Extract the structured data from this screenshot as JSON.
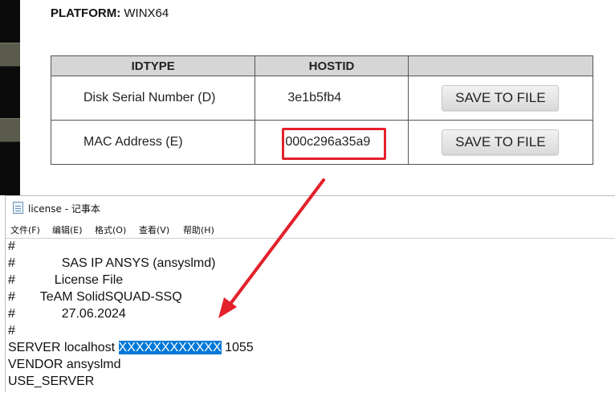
{
  "platform": {
    "label": "PLATFORM:",
    "value": "WINX64"
  },
  "table": {
    "headers": [
      "IDTYPE",
      "HOSTID",
      ""
    ],
    "rows": [
      {
        "idtype": "Disk Serial Number (D)",
        "hostid": "3e1b5fb4",
        "action": "SAVE TO FILE"
      },
      {
        "idtype": "MAC Address (E)",
        "hostid": "000c296a35a9",
        "action": "SAVE TO FILE"
      }
    ]
  },
  "annotation": {
    "color": "#e3212b"
  },
  "notepad": {
    "title": "license - 记事本",
    "menu": [
      "文件(F)",
      "编辑(E)",
      "格式(O)",
      "查看(V)",
      "帮助(H)"
    ],
    "lines": [
      "#",
      "#             SAS IP ANSYS (ansyslmd)",
      "#           License File",
      "#       TeAM SolidSQUAD-SSQ",
      "#             27.06.2024",
      "#"
    ],
    "server": {
      "prefix": "SERVER localhost ",
      "selected": "XXXXXXXXXXXX",
      "suffix": " 1055"
    },
    "vendor": "VENDOR ansyslmd",
    "use_server": "USE_SERVER"
  }
}
